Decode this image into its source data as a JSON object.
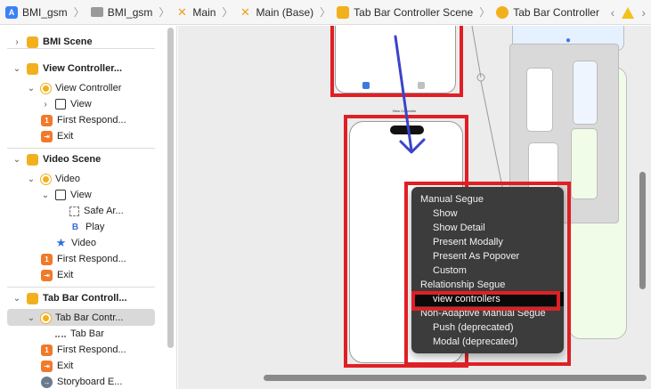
{
  "breadcrumb": {
    "items": [
      {
        "label": "BMI_gsm",
        "icon": "app-icon"
      },
      {
        "label": "BMI_gsm",
        "icon": "folder-icon"
      },
      {
        "label": "Main",
        "icon": "storyboard-icon"
      },
      {
        "label": "Main (Base)",
        "icon": "storyboard-icon"
      },
      {
        "label": "Tab Bar Controller Scene",
        "icon": "scene-icon"
      },
      {
        "label": "Tab Bar Controller",
        "icon": "view-controller-icon"
      }
    ]
  },
  "outline": {
    "rows": [
      {
        "label": "BMI Scene",
        "icon": "scene-icon",
        "disclosure": "›",
        "bold": true
      },
      {
        "label": "View Controller...",
        "icon": "scene-icon",
        "disclosure": "⌄",
        "bold": true
      },
      {
        "label": "View Controller",
        "icon": "view-controller-icon",
        "disclosure": "⌄"
      },
      {
        "label": "View",
        "icon": "view-icon",
        "disclosure": "›"
      },
      {
        "label": "First Respond...",
        "icon": "first-responder-icon",
        "disclosure": ""
      },
      {
        "label": "Exit",
        "icon": "exit-icon",
        "disclosure": ""
      },
      {
        "label": "Video Scene",
        "icon": "scene-icon",
        "disclosure": "⌄",
        "bold": true
      },
      {
        "label": "Video",
        "icon": "view-controller-icon",
        "disclosure": "⌄"
      },
      {
        "label": "View",
        "icon": "view-icon",
        "disclosure": "⌄"
      },
      {
        "label": "Safe Ar...",
        "icon": "safe-area-icon",
        "disclosure": ""
      },
      {
        "label": "Play",
        "icon": "button-icon",
        "disclosure": ""
      },
      {
        "label": "Video",
        "icon": "tab-bar-item-icon",
        "disclosure": ""
      },
      {
        "label": "First Respond...",
        "icon": "first-responder-icon",
        "disclosure": ""
      },
      {
        "label": "Exit",
        "icon": "exit-icon",
        "disclosure": ""
      },
      {
        "label": "Tab Bar Controll...",
        "icon": "scene-icon",
        "disclosure": "⌄",
        "bold": true
      },
      {
        "label": "Tab Bar Contr...",
        "icon": "tab-bar-controller-icon",
        "disclosure": "⌄"
      },
      {
        "label": "Tab Bar",
        "icon": "tab-bar-icon",
        "disclosure": ""
      },
      {
        "label": "First Respond...",
        "icon": "first-responder-icon",
        "disclosure": ""
      },
      {
        "label": "Exit",
        "icon": "exit-icon",
        "disclosure": ""
      },
      {
        "label": "Storyboard E...",
        "icon": "storyboard-entry-icon",
        "disclosure": ""
      }
    ]
  },
  "canvas": {
    "scene_title": "View Controller"
  },
  "context_menu": {
    "items": [
      {
        "label": "Manual Segue",
        "type": "header"
      },
      {
        "label": "Show",
        "type": "item"
      },
      {
        "label": "Show Detail",
        "type": "item"
      },
      {
        "label": "Present Modally",
        "type": "item"
      },
      {
        "label": "Present As Popover",
        "type": "item"
      },
      {
        "label": "Custom",
        "type": "item"
      },
      {
        "label": "Relationship Segue",
        "type": "header"
      },
      {
        "label": "view controllers",
        "type": "item",
        "highlighted": true
      },
      {
        "label": "Non-Adaptive Manual Segue",
        "type": "header"
      },
      {
        "label": "Push (deprecated)",
        "type": "item"
      },
      {
        "label": "Modal (deprecated)",
        "type": "item"
      }
    ]
  },
  "colors": {
    "annotation_red": "#e01f25",
    "drag_arrow_blue": "#3b43c9",
    "menu_background": "#3c3c3c",
    "accent_yellow": "#f2b01e"
  }
}
